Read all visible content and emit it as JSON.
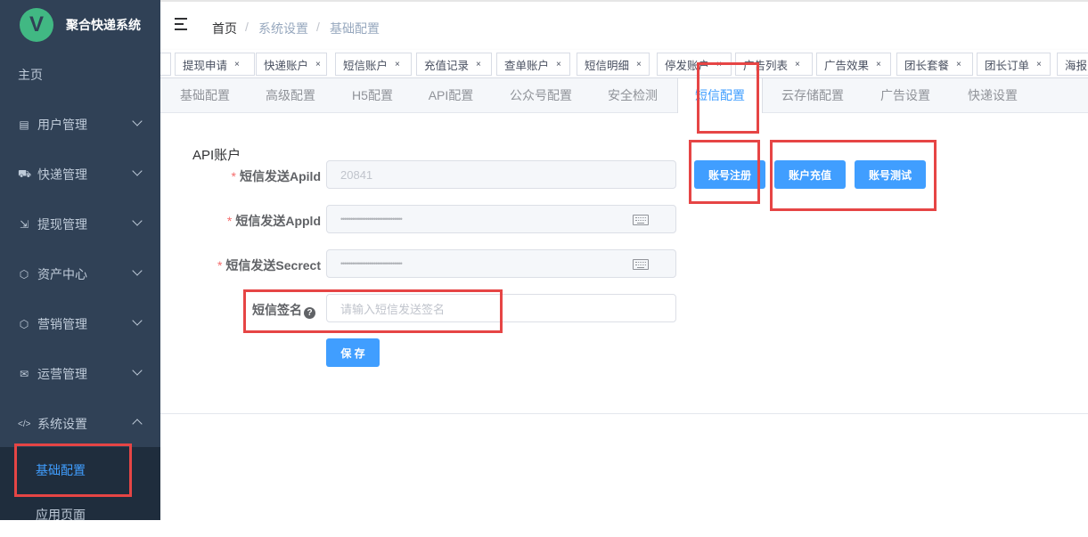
{
  "app": {
    "logo_letter": "V",
    "title": "聚合快递系统"
  },
  "sidebar": {
    "items": [
      {
        "label": "主页",
        "icon": ""
      },
      {
        "label": "用户管理",
        "icon": "▤"
      },
      {
        "label": "快递管理",
        "icon": "⛟"
      },
      {
        "label": "提现管理",
        "icon": "⇲"
      },
      {
        "label": "资产中心",
        "icon": "⬡"
      },
      {
        "label": "营销管理",
        "icon": "⬡"
      },
      {
        "label": "运营管理",
        "icon": "✉"
      },
      {
        "label": "系统设置",
        "icon": "</>"
      }
    ],
    "submenu": [
      {
        "label": "基础配置"
      },
      {
        "label": "应用页面"
      }
    ],
    "active_color": "#409eff"
  },
  "breadcrumb": {
    "items": [
      "首页",
      "系统设置",
      "基础配置"
    ],
    "sep": "/"
  },
  "tags": [
    "提现申请",
    "快递账户",
    "短信账户",
    "充值记录",
    "查单账户",
    "短信明细",
    "停发账户",
    "广告列表",
    "广告效果",
    "团长套餐",
    "团长订单",
    "海报"
  ],
  "tabs": [
    "基础配置",
    "高级配置",
    "H5配置",
    "API配置",
    "公众号配置",
    "安全检测",
    "短信配置",
    "云存储配置",
    "广告设置",
    "快递设置"
  ],
  "form": {
    "section_title": "API账户",
    "fields": [
      {
        "label": "短信发送Apild",
        "required": true,
        "value": "20841"
      },
      {
        "label": "短信发送Appld",
        "required": true,
        "value": "••••••••••••••••••••••••••••••••"
      },
      {
        "label": "短信发送Secrect",
        "required": true,
        "value": "••••••••••••••••••••••••••••••••"
      },
      {
        "label": "短信签名",
        "required": false,
        "placeholder": "请输入短信发送签名"
      }
    ],
    "save_label": "保 存"
  },
  "buttons": {
    "register": "账号注册",
    "recharge": "账户充值",
    "test": "账号测试"
  },
  "colors": {
    "sidebar_bg": "#304156",
    "primary": "#409eff",
    "highlight": "#e64545",
    "logo": "#41b883"
  }
}
